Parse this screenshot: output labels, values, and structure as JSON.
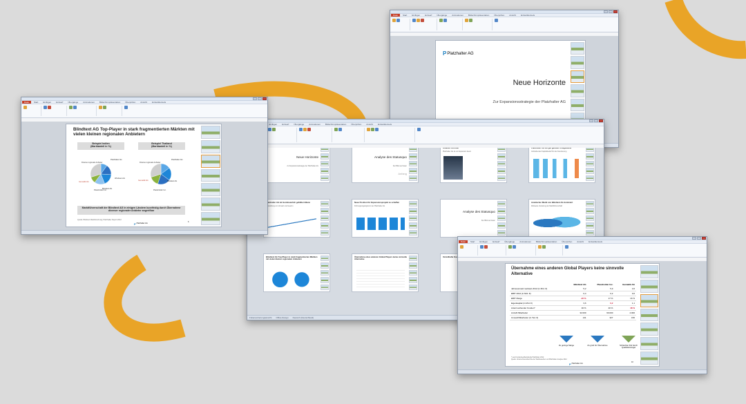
{
  "colors": {
    "background": "#dbdbdb",
    "arc": "#e9a427",
    "accent": "#1b7fc0",
    "office_red": "#c53d25"
  },
  "ribbon_tabs": [
    "Datei",
    "Start",
    "Einfügen",
    "Entwurf",
    "Übergänge",
    "Animationen",
    "Bildschirmpräsentation",
    "Überprüfen",
    "Ansicht",
    "Entwicklertools"
  ],
  "win_a": {
    "slide": {
      "title": "Blindtext AG Top-Player in stark fragmentierten Märkten mit vielen kleinen regionalen Anbietern",
      "left_header": "Beispiel Indien\n(Marktanteil in %)",
      "right_header": "Beispiel Thailand\n(Marktanteil in %)",
      "left_labels": [
        "Platzhalter AG",
        "Diverse regionale Anbieter",
        "Windows AG",
        "Gemadik AG",
        "Blindtext AG",
        "Placeholder Inc."
      ],
      "right_labels": [
        "Platzhalter AG",
        "Diverse regionale Anbieter",
        "Gemadik AG",
        "Blindtext AG",
        "Placeholder Inc."
      ],
      "footer_box": "Marktführerschaft der Blindtext AG in einigen Ländern kurzfristig durch Übernahme diverser regionaler Anbieter angreifbar",
      "source": "Quelle: Blindtext Marktforschung; Platzhalter Report 2012",
      "logo": "Platzhalter AG",
      "page": "6"
    }
  },
  "win_b": {
    "slide": {
      "logo": "Platzhalter AG",
      "title": "Neue Horizonte",
      "subtitle": "Zur Expansionsstrategie der Platzhalter AG"
    }
  },
  "win_c": {
    "slides": [
      {
        "n": "1",
        "title": "Neue Horizonte",
        "sub": "zur Expansionsstrategie der Platzhalter AG",
        "logo": "Platzhalter AG"
      },
      {
        "n": "2",
        "title": "Analyse des Statusquo",
        "sub": "Der Blick auf Asien",
        "extra": "Anfang"
      },
      {
        "n": "3",
        "title": "Kreative Vorreiter",
        "sub": "Platzhalter AG ist vor Expansion bereit"
      },
      {
        "n": "4",
        "title": "Platzhalter AG mit gut gefüllter Kriegskasse",
        "sub": "Verbleibender Kapitalbedarf für die Finanzierung"
      },
      {
        "n": "5",
        "title": "Platzhalter AG mit kontinuierlich gefüllter Bilanz",
        "sub": "Entwicklung von Umsatz und Gewinn"
      },
      {
        "n": "6",
        "title": "Neue Position für Expansionsprojekt zu schaffen",
        "sub": "Führungsorganigramm der Platzhalter AG"
      },
      {
        "n": "7",
        "title": "Analyse des Statusquo",
        "sub": "Der Blick auf Asien"
      },
      {
        "n": "8",
        "title": "Asiatischer Markt von Blindtext AG dominiert",
        "sub": "Weltweite Verteilung der Marktführerschaft"
      },
      {
        "n": "9",
        "title": "Blindtext AG Top-Player in stark fragmentierten Märkten mit vielen kleinen regionalen Anbietern",
        "sub": ""
      },
      {
        "n": "10",
        "title": "Übernahme eines anderen Global Players keine sinnvolle Alternative",
        "sub": ""
      },
      {
        "n": "11",
        "title": "Vorteilhafte Kooperation",
        "sub": ""
      }
    ],
    "status": [
      "Foliensortierungsansicht",
      "Office-Design",
      "Deutsch (Deutschland)"
    ]
  },
  "win_d": {
    "slide": {
      "title": "Übernahme eines anderen Global Players keine sinnvolle Alternative",
      "columns": [
        "Blindtext AG",
        "Placeholder Inc.",
        "Gemadik AG"
      ],
      "rows": [
        {
          "label": "Jahresumsatz weltweit 2012 (in Mrd. €)",
          "values": [
            "5,2",
            "5,9",
            "3,6"
          ],
          "red": []
        },
        {
          "label": "EBIT 2012 (in Mrd. €)",
          "values": [
            "0,4",
            "0,2",
            "0,6"
          ],
          "red": []
        },
        {
          "label": "EBIT Marge",
          "values": [
            "-22 %",
            "17 %",
            "16 %"
          ],
          "red": [
            0
          ]
        },
        {
          "label": "Eigenkapital (in Mrd. €)",
          "values": [
            "3,6",
            "0,2",
            "1,1"
          ],
          "red": [
            1
          ]
        },
        {
          "label": "Anteil suchender Kunden*",
          "values": [
            "46 %",
            "40 %",
            "48 %"
          ],
          "red": [
            2
          ]
        },
        {
          "label": "Anzahl Mitarbeiter",
          "values": [
            "32.000",
            "60.000",
            "4.000"
          ],
          "red": []
        },
        {
          "label": "Umsatz/Mitarbeiter (in Tsd. €)",
          "values": [
            "211",
            "327",
            "156"
          ],
          "red": []
        }
      ],
      "verdicts": [
        "Zu geringe Marge",
        "Zu groß für Übernahme",
        "Schlechter Ruf durch Qualitätsmängel"
      ],
      "footnote": "* Laut Kundenfeedbackstudie Platzhalter 2012\nQuelle: Unternehmensberichte der Wettbewerber und Platzhalter-Analyse 2012",
      "logo": "Platzhalter AG",
      "page": "10"
    }
  },
  "chart_data": [
    {
      "type": "pie",
      "title": "Beispiel Indien (Marktanteil in %)",
      "categories": [
        "Platzhalter AG",
        "Windows AG",
        "Placeholder Inc.",
        "Blindtext AG",
        "Gemadik AG",
        "Diverse regionale Anbieter"
      ],
      "values": [
        10,
        16,
        18,
        16,
        10,
        30
      ]
    },
    {
      "type": "pie",
      "title": "Beispiel Thailand (Marktanteil in %)",
      "categories": [
        "Platzhalter AG",
        "Placeholder Inc.",
        "Blindtext AG",
        "Gemadik AG",
        "Diverse regionale Anbieter"
      ],
      "values": [
        15,
        20,
        20,
        15,
        30
      ]
    }
  ]
}
